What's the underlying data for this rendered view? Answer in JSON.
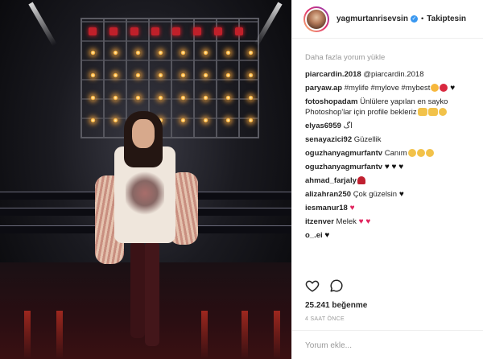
{
  "post": {
    "username": "yagmurtanrisevsin",
    "follow_label": "Takiptesin",
    "separator": "•",
    "load_more": "Daha fazla yorum yükle",
    "likes": "25.241 beğenme",
    "timestamp": "4 SAAT ÖNCE",
    "comment_placeholder": "Yorum ekle..."
  },
  "comments": [
    {
      "user": "piarcardin.2018",
      "text": "@piarcardin.2018",
      "emoji": []
    },
    {
      "user": "paryaw.ap",
      "text": "#mylife #mylove #mybest",
      "emoji": [
        "cat",
        "kiss",
        "heart-b"
      ]
    },
    {
      "user": "fotoshopadam",
      "text": "Ünlülere yapılan en sayko Photoshop'lar için profile bekleriz",
      "emoji": [
        "hand",
        "hand",
        "face"
      ]
    },
    {
      "user": "elyas6959",
      "text": "اگ",
      "emoji": []
    },
    {
      "user": "senayazici92",
      "text": "Güzellik",
      "emoji": []
    },
    {
      "user": "oguzhanyagmurfantv",
      "text": "Canım",
      "emoji": [
        "face",
        "face",
        "face"
      ]
    },
    {
      "user": "oguzhanyagmurfantv",
      "text": "",
      "emoji": [
        "heart-b",
        "heart-b",
        "heart-b"
      ]
    },
    {
      "user": "ahmad_farjaly",
      "text": "",
      "emoji": [
        "rose"
      ]
    },
    {
      "user": "alizahran250",
      "text": "Çok güzelsin",
      "emoji": [
        "heart-b"
      ]
    },
    {
      "user": "iesmanur18",
      "text": "",
      "emoji": [
        "heart-r"
      ]
    },
    {
      "user": "itzenver",
      "text": "Melek",
      "emoji": [
        "heart-r",
        "heart-r"
      ]
    },
    {
      "user": "o_.ei",
      "text": "",
      "emoji": [
        "heart-b"
      ]
    }
  ],
  "icons": {
    "like": "heart-outline-icon",
    "comment": "speech-bubble-icon",
    "verified": "verified-badge-icon"
  },
  "colors": {
    "verified": "#3897f0",
    "muted": "#999999",
    "text": "#262626"
  }
}
